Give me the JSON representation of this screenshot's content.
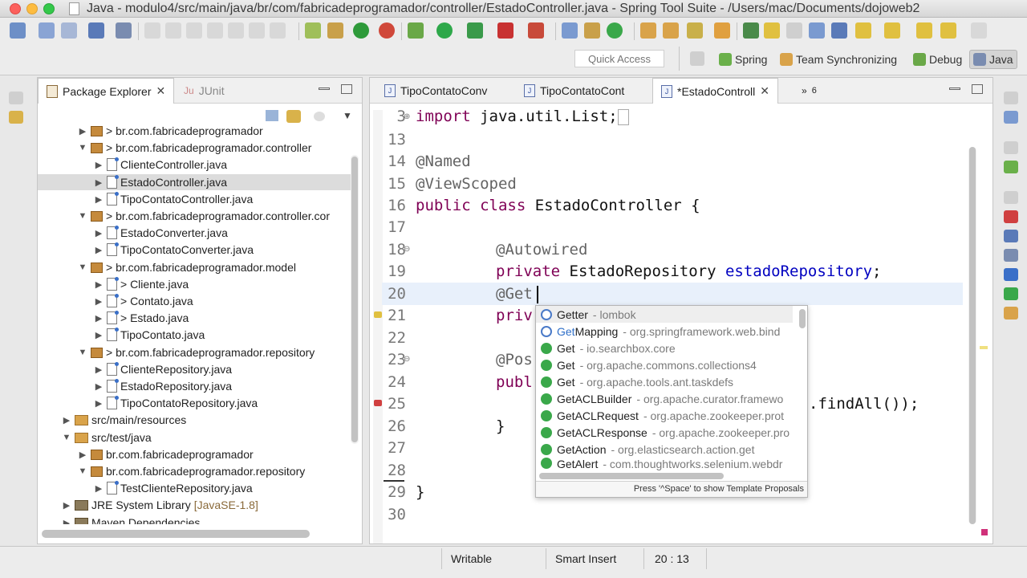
{
  "window": {
    "title": "Java - modulo4/src/main/java/br/com/fabricadeprogramador/controller/EstadoController.java - Spring Tool Suite - /Users/mac/Documents/dojoweb2"
  },
  "toolbar": {
    "quick_access_placeholder": "Quick Access",
    "perspectives": [
      {
        "label": "Spring",
        "icon": "spring-leaf-icon"
      },
      {
        "label": "Team Synchronizing",
        "icon": "team-sync-icon"
      },
      {
        "label": "Debug",
        "icon": "debug-bug-icon"
      },
      {
        "label": "Java",
        "icon": "java-perspective-icon",
        "active": true
      }
    ]
  },
  "package_explorer": {
    "tabs": [
      {
        "label": "Package Explorer",
        "active": true
      },
      {
        "label": "JUnit",
        "active": false
      }
    ],
    "tree": [
      {
        "label": "> br.com.fabricadeprogramador",
        "type": "package",
        "expanded": false
      },
      {
        "label": "> br.com.fabricadeprogramador.controller",
        "type": "package",
        "expanded": true
      },
      {
        "label": "ClienteController.java",
        "type": "java"
      },
      {
        "label": "EstadoController.java",
        "type": "java",
        "selected": true
      },
      {
        "label": "TipoContatoController.java",
        "type": "java"
      },
      {
        "label": "> br.com.fabricadeprogramador.controller.cor",
        "type": "package",
        "expanded": true
      },
      {
        "label": "EstadoConverter.java",
        "type": "java"
      },
      {
        "label": "TipoContatoConverter.java",
        "type": "java"
      },
      {
        "label": "> br.com.fabricadeprogramador.model",
        "type": "package",
        "expanded": true
      },
      {
        "label": "> Cliente.java",
        "type": "java"
      },
      {
        "label": "> Contato.java",
        "type": "java"
      },
      {
        "label": "> Estado.java",
        "type": "java"
      },
      {
        "label": "TipoContato.java",
        "type": "java"
      },
      {
        "label": "> br.com.fabricadeprogramador.repository",
        "type": "package",
        "expanded": true
      },
      {
        "label": "ClienteRepository.java",
        "type": "java"
      },
      {
        "label": "EstadoRepository.java",
        "type": "java"
      },
      {
        "label": "TipoContatoRepository.java",
        "type": "java"
      },
      {
        "label": "src/main/resources",
        "type": "folder",
        "expanded": false
      },
      {
        "label": "src/test/java",
        "type": "folder",
        "expanded": true
      },
      {
        "label": "br.com.fabricadeprogramador",
        "type": "package",
        "expanded": false
      },
      {
        "label": "br.com.fabricadeprogramador.repository",
        "type": "package",
        "expanded": true
      },
      {
        "label": "TestClienteRepository.java",
        "type": "java"
      },
      {
        "label": "JRE System Library",
        "suffix": "[JavaSE-1.8]",
        "type": "library",
        "expanded": false
      },
      {
        "label": "Maven Dependencies",
        "type": "library",
        "expanded": false
      }
    ]
  },
  "editor": {
    "tabs": [
      {
        "label": "TipoContatoConv",
        "active": false
      },
      {
        "label": "TipoContatoCont",
        "active": false
      },
      {
        "label": "*EstadoControll",
        "active": true
      }
    ],
    "overflow_count": "6",
    "line_numbers": [
      "3",
      "13",
      "14",
      "15",
      "16",
      "17",
      "18",
      "19",
      "20",
      "21",
      "22",
      "23",
      "24",
      "25",
      "26",
      "27",
      "28",
      "29",
      "30"
    ],
    "code": {
      "l3_kw": "import",
      "l3_rest": " java.util.List;",
      "l14": "@Named",
      "l15": "@ViewScoped",
      "l16_kw": "public class",
      "l16_rest": " EstadoController {",
      "l18": "@Autowired",
      "l19_kw": "private",
      "l19_type": " EstadoRepository ",
      "l19_field": "estadoRepository",
      "l19_end": ";",
      "l20": "@Get",
      "l21": "priv",
      "l23": "@Pos",
      "l24": "publ",
      "l25": ".findAll());",
      "l26": "}",
      "l29": "}"
    }
  },
  "autocomplete": {
    "items": [
      {
        "name": "Getter",
        "pkg": " - lombok",
        "icon": "annotation-icon"
      },
      {
        "name_hl": "Get",
        "name_rest": "Mapping",
        "pkg": " - org.springframework.web.bind",
        "icon": "annotation-icon"
      },
      {
        "name": "Get",
        "pkg": " - io.searchbox.core",
        "icon": "class-icon"
      },
      {
        "name": "Get",
        "pkg": " - org.apache.commons.collections4",
        "icon": "class-icon"
      },
      {
        "name": "Get",
        "pkg": " - org.apache.tools.ant.taskdefs",
        "icon": "class-icon"
      },
      {
        "name": "GetACLBuilder",
        "pkg": " - org.apache.curator.framewo",
        "icon": "class-icon"
      },
      {
        "name": "GetACLRequest",
        "pkg": " - org.apache.zookeeper.prot",
        "icon": "class-icon"
      },
      {
        "name": "GetACLResponse",
        "pkg": " - org.apache.zookeeper.pro",
        "icon": "class-icon"
      },
      {
        "name": "GetAction",
        "pkg": " - org.elasticsearch.action.get",
        "icon": "class-icon"
      },
      {
        "name": "GetAlert",
        "pkg": " - com.thoughtworks.selenium.webdr",
        "icon": "class-icon"
      }
    ],
    "footer": "Press '^Space' to show Template Proposals"
  },
  "statusbar": {
    "writable": "Writable",
    "insert_mode": "Smart Insert",
    "position": "20 : 13"
  },
  "colors": {
    "keyword": "#7f0055",
    "annotation": "#646464",
    "field": "#0000c0",
    "current_line": "#e8f0fb"
  }
}
